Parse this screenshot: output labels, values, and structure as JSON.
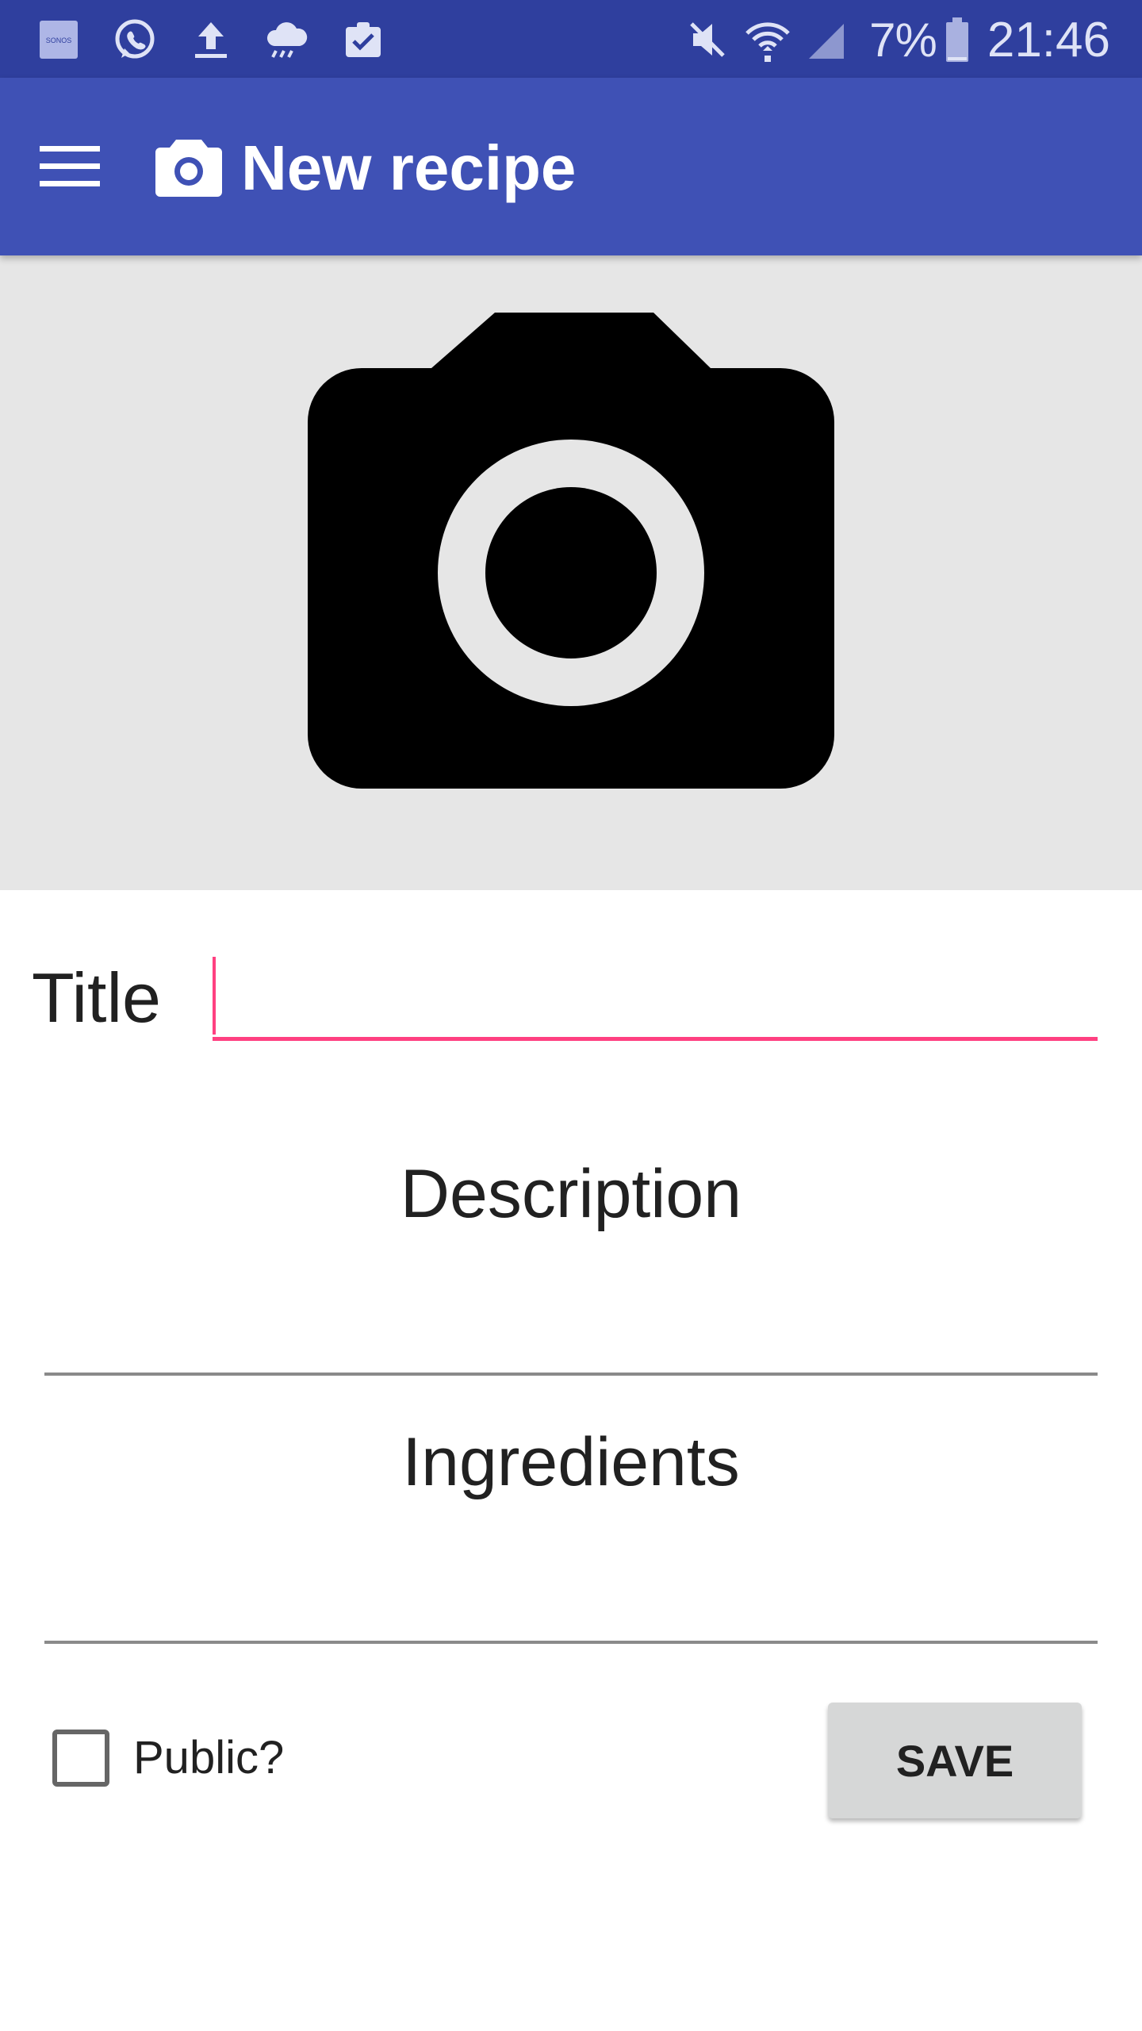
{
  "status_bar": {
    "icons": [
      "sonos-icon",
      "whatsapp-icon",
      "upload-icon",
      "cloud-rain-icon",
      "clipboard-check-icon"
    ],
    "sonos_text": "SONOS",
    "battery_percent": "7%",
    "time": "21:46"
  },
  "app_bar": {
    "title": "New recipe",
    "menu_icon": "menu-icon",
    "title_icon": "camera-icon",
    "background": "#3f51b5"
  },
  "photo": {
    "icon": "camera-icon",
    "background": "#e6e6e6"
  },
  "form": {
    "title_label": "Title",
    "title_value": "",
    "description_hint": "Description",
    "ingredients_hint": "Ingredients",
    "public_label": "Public?",
    "public_checked": false,
    "save_label": "SAVE",
    "accent": "#ff4081"
  }
}
